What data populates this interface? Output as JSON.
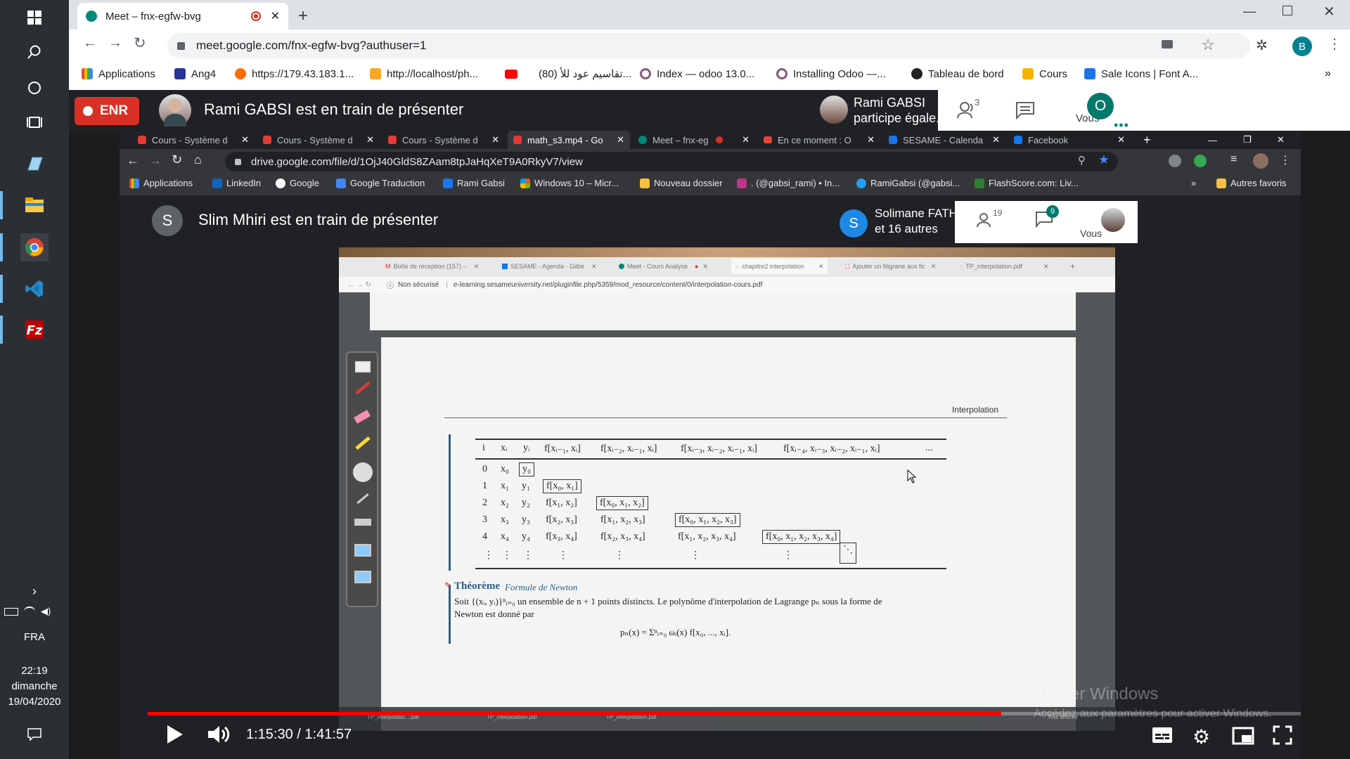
{
  "taskbar": {
    "icons": [
      "windows-icon",
      "search-icon",
      "cortana-icon",
      "task-view-icon",
      "app-icon",
      "file-explorer-icon",
      "chrome-icon",
      "vscode-icon",
      "filezilla-icon"
    ],
    "language": "FRA",
    "time": "22:19",
    "day": "dimanche",
    "date": "19/04/2020"
  },
  "outer_tab": {
    "title": "Meet – fnx-egfw-bvg"
  },
  "outer_url": "meet.google.com/fnx-egfw-bvg?authuser=1",
  "profile_initial": "B",
  "bookmarks": [
    "Applications",
    "Ang4",
    "https://179.43.183.1...",
    "http://localhost/ph...",
    "(80) تقاسيم عود للأ...",
    "Index — odoo 13.0...",
    "Installing Odoo —...",
    "Tableau de bord",
    "Cours",
    "Sale Icons | Font A..."
  ],
  "meet": {
    "recording_label": "ENR",
    "presenting_text": "Rami GABSI est en train de présenter",
    "participant_name": "Rami GABSI",
    "participant_sub": "participe égale...",
    "people_count": "3",
    "you_label": "Vous",
    "you_initial": "O"
  },
  "inner": {
    "tabs": [
      "Cours - Système d",
      "Cours - Système d",
      "Cours - Système d",
      "math_s3.mp4 - Go",
      "Meet – fnx-eg",
      "En ce moment : O",
      "SESAME - Calenda",
      "Facebook"
    ],
    "url": "drive.google.com/file/d/1OjJ40GldS8ZAam8tpJaHqXeT9A0RkyV7/view",
    "bookmarks": [
      "Applications",
      "LinkedIn",
      "Google",
      "Google Traduction",
      "Rami Gabsi",
      "Windows 10 – Micr...",
      "Nouveau dossier",
      ". (@gabsi_rami) • In...",
      "RamiGabsi (@gabsi...",
      "FlashScore.com: Liv...",
      "Autres favoris"
    ],
    "presenting_initial": "S",
    "presenting_text": "Slim Mhiri est en train de présenter",
    "participant_initial": "S",
    "participant_name": "Solimane FATHA...",
    "participant_sub": "et 16 autres",
    "people_count": "19",
    "chat_count": "9",
    "you_label": "Vous"
  },
  "video_page": {
    "tabs": [
      "Boîte de réception (157) –",
      "SESAME - Agenda - Gilbe",
      "Meet - Cours Analyse",
      "chapitre2 interpolation",
      "Ajouter un filigrane aux fic",
      "TP_interpolation.pdf"
    ],
    "insecure_label": "Non sécurisé",
    "url": "e-learning.sesameuniversity.net/pluginfile.php/5359/mod_resource/content/0/interpolation-cours.pdf",
    "header_right": "Interpolation",
    "table": {
      "headers": [
        "i",
        "xᵢ",
        "yᵢ",
        "f[xᵢ₋₁, xᵢ]",
        "f[xᵢ₋₂, xᵢ₋₁, xᵢ]",
        "f[xᵢ₋₃, xᵢ₋₂, xᵢ₋₁, xᵢ]",
        "f[xᵢ₋₄, xᵢ₋₃, xᵢ₋₂, xᵢ₋₁, xᵢ]",
        "..."
      ],
      "rows": [
        [
          "0",
          "x₀",
          "y₀",
          "",
          "",
          "",
          ""
        ],
        [
          "1",
          "x₁",
          "y₁",
          "f[x₀, x₁]",
          "",
          "",
          ""
        ],
        [
          "2",
          "x₂",
          "y₂",
          "f[x₁, x₂]",
          "f[x₀, x₁, x₂]",
          "",
          ""
        ],
        [
          "3",
          "x₃",
          "y₃",
          "f[x₂, x₃]",
          "f[x₁, x₂, x₃]",
          "f[x₀, x₁, x₂, x₃]",
          ""
        ],
        [
          "4",
          "x₄",
          "y₄",
          "f[x₃, x₄]",
          "f[x₂, x₃, x₄]",
          "f[x₁, x₂, x₃, x₄]",
          "f[x₀, x₁, x₂, x₃, x₄]"
        ]
      ],
      "dots": "⋮",
      "ddots": "⋱"
    },
    "theorem_title": "Théorème",
    "theorem_subtitle": "Formule de Newton",
    "theorem_line1": "Soit {(xᵢ, yᵢ)}ⁿᵢ₌₀ un ensemble de n + 1 points distincts. Le polynôme d'interpolation de Lagrange pₙ sous la forme de",
    "theorem_line2": "Newton est donné par",
    "formula": "pₙ(x) = Σⁿᵢ₌₀ ωᵢ(x) f[x₀, ..., xᵢ].",
    "bottom_files": [
      "TP_interpolatio....pdf",
      "TP_interpolation.pdf",
      "TP_interpolation.pdf"
    ],
    "bottom_right": "Tout afficher"
  },
  "player": {
    "time": "1:15:30 / 1:41:57",
    "progress": 0.7405
  },
  "watermark": {
    "title": "Activer Windows",
    "subtitle": "Accédez aux paramètres pour activer Windows."
  },
  "colors": {
    "accent_red": "#ff0000",
    "meet_blue": "#1a73e8",
    "teal": "#00796b",
    "recording_red": "#d93025"
  }
}
